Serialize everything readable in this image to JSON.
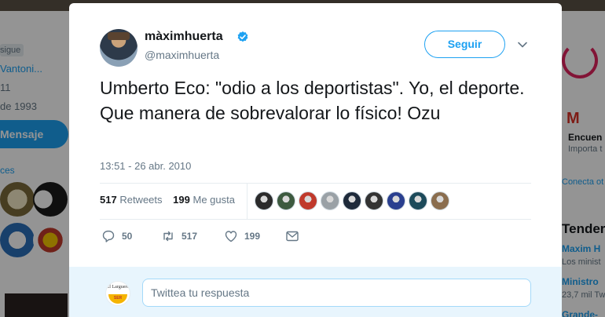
{
  "background": {
    "left": {
      "follows_you": "sigue",
      "line1": "Vantoni...",
      "line2": "11",
      "line3": "de 1993",
      "message_button": "Mensaje",
      "line4": "ces"
    },
    "right": {
      "gmail_icon": "M",
      "card_title": "Encuen",
      "card_sub": "Importa t",
      "connect": "Conecta ot",
      "trends_title": "Tender",
      "trend1": "Maxim H",
      "trend1_sub": "Los minist",
      "trend2": "Ministro",
      "trend2_sub": "23,7 mil Tw",
      "trend3": "Grande-"
    }
  },
  "tweet": {
    "author_name": "màximhuerta",
    "author_handle": "@maximhuerta",
    "verified_icon": "verified-badge-icon",
    "follow_label": "Seguir",
    "text": "Umberto Eco: \"odio a los deportistas\". Yo, el deporte. Que manera de sobrevalorar lo físico! Ozu",
    "timestamp": "13:51 - 26 abr. 2010",
    "retweets_count": "517",
    "retweets_label": "Retweets",
    "likes_count": "199",
    "likes_label": "Me gusta",
    "likers": [
      "#2b2b2b",
      "#3d5a3f",
      "#c0392b",
      "#9aa1a6",
      "#1e2a3a",
      "#333333",
      "#2a3f8f",
      "#1c4a5a",
      "#8a6d4e"
    ],
    "actions": {
      "reply_count": "50",
      "retweet_count": "517",
      "like_count": "199"
    },
    "reply": {
      "avatar_top": "El Larguero",
      "avatar_bottom": "SER",
      "placeholder": "Twittea tu respuesta"
    }
  },
  "colors": {
    "accent": "#1da1f2",
    "text": "#14171a",
    "muted": "#657786"
  }
}
